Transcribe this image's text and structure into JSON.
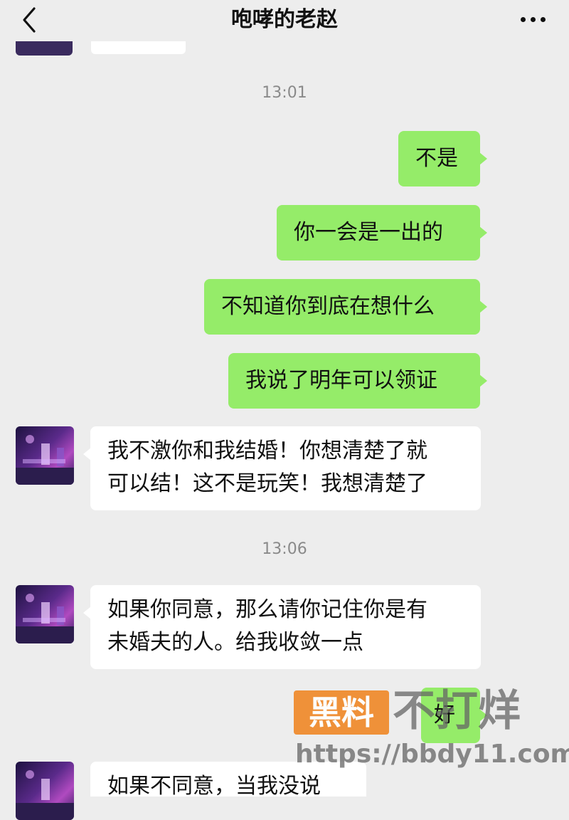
{
  "header": {
    "title": "咆哮的老赵"
  },
  "icons": {
    "back": "chevron-left-icon",
    "more": "more-horizontal-icon"
  },
  "colors": {
    "sent_bubble": "#95ec69",
    "received_bubble": "#ffffff",
    "background": "#ededed",
    "watermark_orange": "#f08a2a"
  },
  "messages": {
    "time1": "13:01",
    "sent1": "不是",
    "sent2": "你一会是一出的",
    "sent3": "不知道你到底在想什么",
    "sent4": "我说了明年可以领证",
    "recv1_line1": "我不激你和我结婚！你想清楚了就",
    "recv1_line2": "可以结！这不是玩笑！我想清楚了",
    "time2": "13:06",
    "recv2_line1": "如果你同意，那么请你记住你是有",
    "recv2_line2": "未婚夫的人。给我收敛一点",
    "sent5": "好",
    "recv3_line1": "如果不同意，当我没说"
  },
  "watermark": {
    "badge": "黑料",
    "text": "不打烊",
    "url": "https://bbdy11.com"
  }
}
